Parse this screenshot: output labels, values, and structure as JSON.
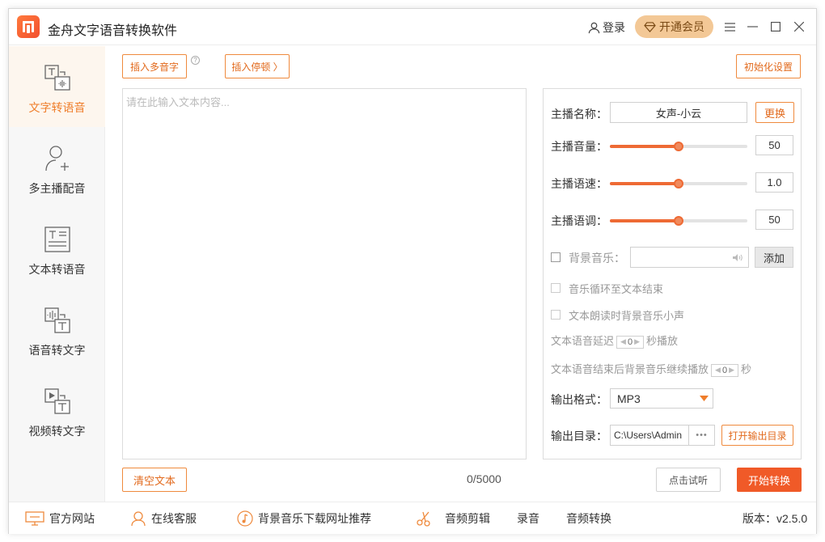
{
  "app": {
    "title": "金舟文字语音转换软件"
  },
  "header": {
    "login_label": "登录",
    "vip_label": "开通会员"
  },
  "sidebar": {
    "items": [
      {
        "label": "文字转语音",
        "active": true
      },
      {
        "label": "多主播配音"
      },
      {
        "label": "文本转语音"
      },
      {
        "label": "语音转文字"
      },
      {
        "label": "视频转文字"
      }
    ]
  },
  "toolbar": {
    "insert_polyphone": "插入多音字",
    "help": "?",
    "insert_pause": "插入停顿 〉",
    "reset_settings": "初始化设置"
  },
  "editor": {
    "placeholder": "请在此输入文本内容...",
    "value": "",
    "counter": "0/5000",
    "clear_label": "清空文本"
  },
  "settings": {
    "anchor_name_label": "主播名称：",
    "anchor_name": "女声-小云",
    "change_label": "更换",
    "volume_label": "主播音量：",
    "volume": "50",
    "volume_fraction": 0.5,
    "speed_label": "主播语速：",
    "speed": "1.0",
    "speed_fraction": 0.5,
    "pitch_label": "主播语调：",
    "pitch": "50",
    "pitch_fraction": 0.5,
    "bgm_label": "背景音乐：",
    "bgm_value": "",
    "add_label": "添加",
    "loop_label": "音乐循环至文本结束",
    "duck_label": "文本朗读时背景音乐小声",
    "delay_prefix": "文本语音延迟",
    "delay_value": "0",
    "delay_suffix": "秒播放",
    "continue_prefix": "文本语音结束后背景音乐继续播放",
    "continue_value": "0",
    "continue_suffix": "秒",
    "format_label": "输出格式：",
    "format_value": "MP3",
    "dir_label": "输出目录：",
    "dir_value": "C:\\Users\\Admin",
    "browse_label": "•••",
    "open_dir_label": "打开输出目录"
  },
  "actions": {
    "preview_label": "点击试听",
    "start_label": "开始转换"
  },
  "footer": {
    "website": "官方网站",
    "service": "在线客服",
    "music_sites": "背景音乐下载网址推荐",
    "audio_edit": "音频剪辑",
    "record": "录音",
    "audio_convert": "音频转换",
    "version": "版本：v2.5.0"
  },
  "colors": {
    "accent": "#ef7d2a",
    "primary": "#f05a28",
    "vip": "#f3c896"
  }
}
